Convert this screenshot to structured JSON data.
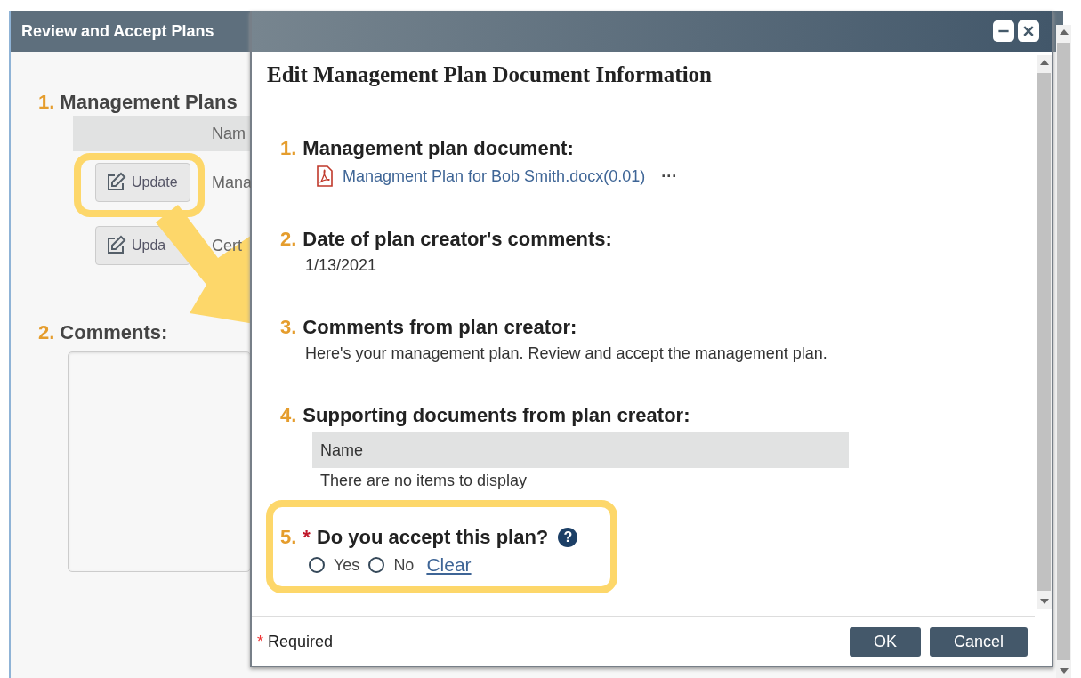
{
  "background_window": {
    "title": "Review and Accept Plans",
    "sections": [
      {
        "number": "1.",
        "label": "Management Plans",
        "kind": "table",
        "column": "Nam",
        "rows": [
          {
            "button": "Update",
            "name": "Mana"
          },
          {
            "button": "Upda",
            "name": "Cert"
          }
        ]
      },
      {
        "number": "2.",
        "label": "Comments:",
        "kind": "textarea"
      }
    ]
  },
  "dialog": {
    "title": "Edit Management Plan Document Information",
    "sections": [
      {
        "number": "1.",
        "label": "Management plan document:",
        "kind": "file",
        "file": "Managment Plan for Bob Smith.docx(0.01)",
        "more": "···"
      },
      {
        "number": "2.",
        "label": "Date of plan creator's comments:",
        "kind": "text",
        "text": "1/13/2021"
      },
      {
        "number": "3.",
        "label": "Comments from plan creator:",
        "kind": "text",
        "text": "Here's your management plan. Review and accept the management plan."
      },
      {
        "number": "4.",
        "label": "Supporting documents from plan creator:",
        "kind": "table",
        "column": "Name",
        "empty": "There are no items to display"
      },
      {
        "number": "5.",
        "label": "Do you accept this plan?",
        "kind": "choice",
        "required": true,
        "help": "?",
        "options": [
          {
            "label": "Yes",
            "selected": false
          },
          {
            "label": "No",
            "selected": false
          }
        ],
        "clear": "Clear"
      }
    ],
    "required_note": "Required",
    "required_mark": "*",
    "buttons": [
      "OK",
      "Cancel"
    ]
  }
}
